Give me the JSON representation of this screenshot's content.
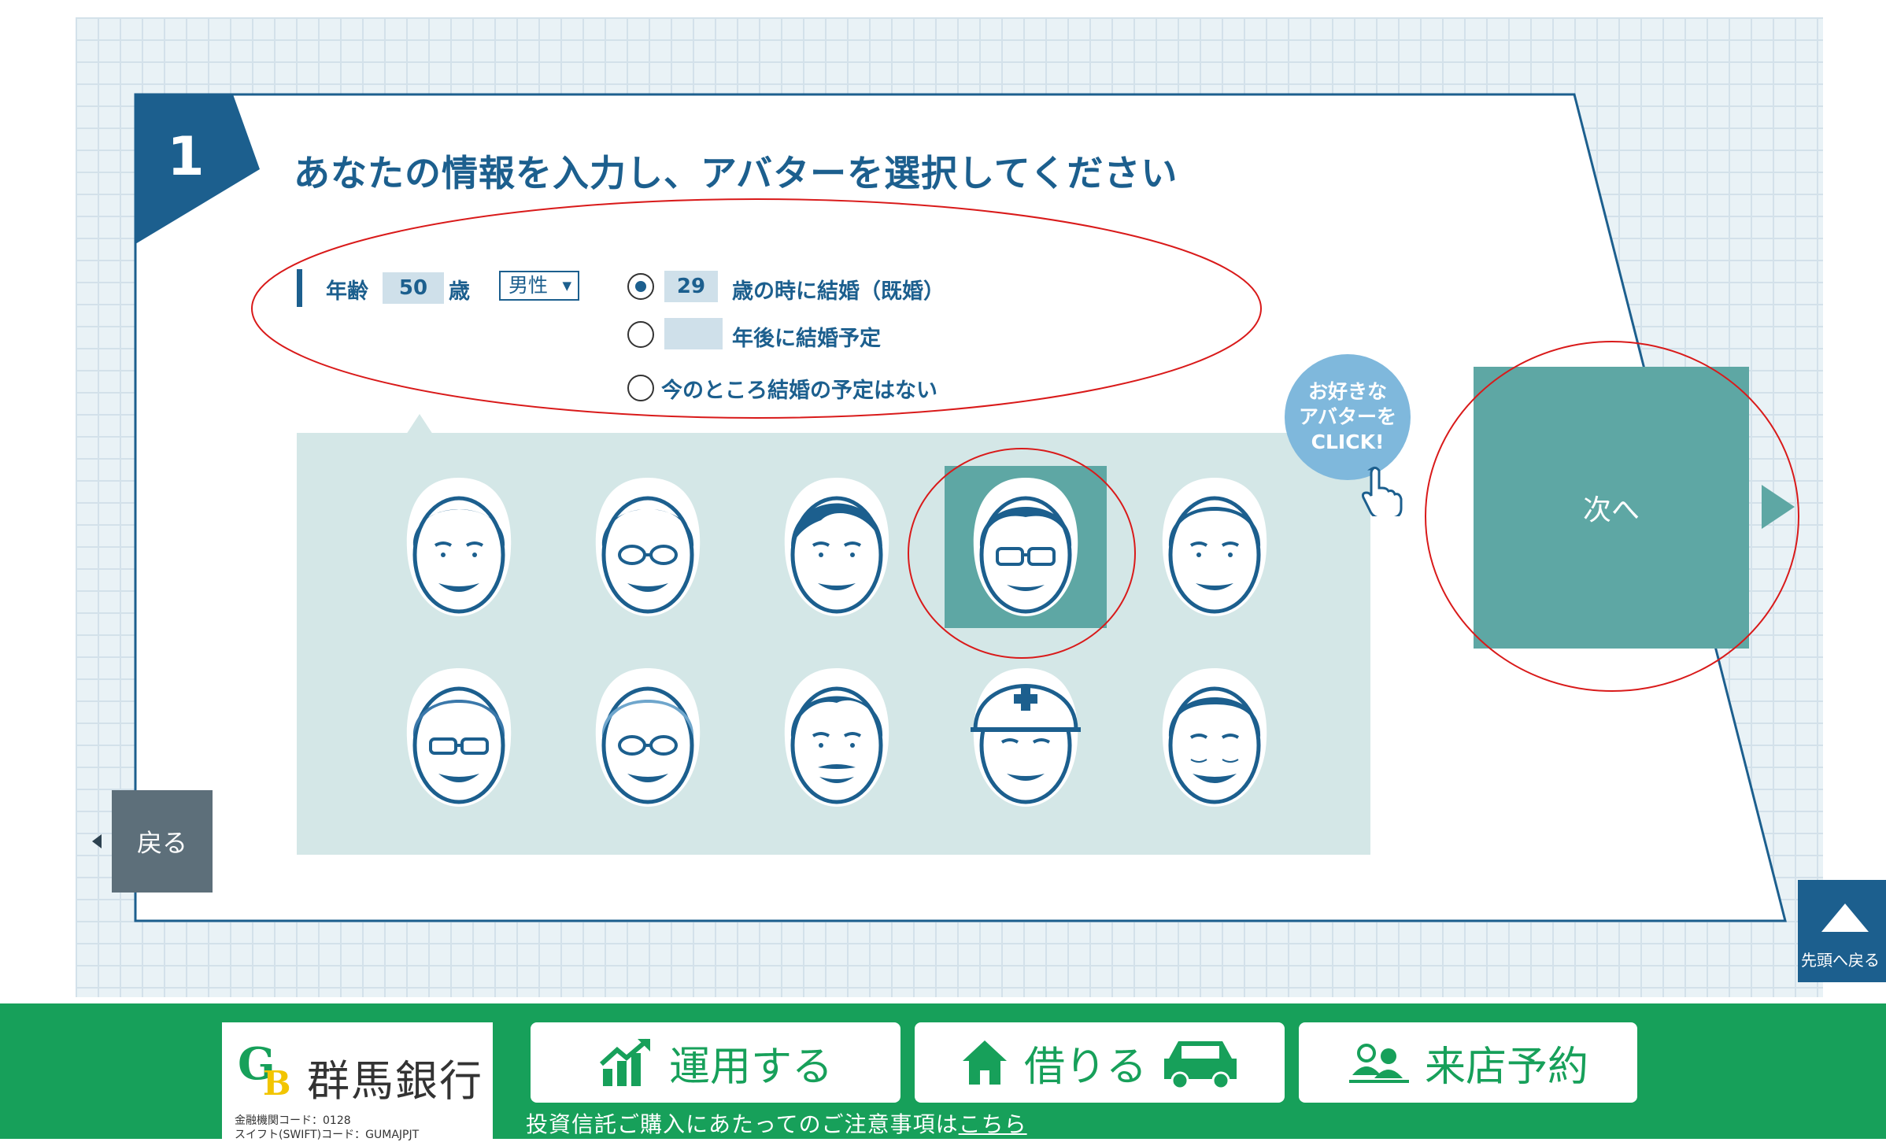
{
  "step": {
    "number": "1",
    "title": "あなたの情報を入力し、アバターを選択してください"
  },
  "form": {
    "age_label": "年齢",
    "age_value": "50",
    "age_unit": "歳",
    "gender_value": "男性",
    "marriage_options": [
      {
        "value": "29",
        "label": "歳の時に結婚（既婚）",
        "checked": true
      },
      {
        "value": "",
        "label": "年後に結婚予定",
        "checked": false
      },
      {
        "label": "今のところ結婚の予定はない",
        "checked": false
      }
    ]
  },
  "avatar_prompt": {
    "line1": "お好きな",
    "line2": "アバターを",
    "line3": "CLICK!"
  },
  "avatars": {
    "selected_index": 3,
    "count": 10
  },
  "buttons": {
    "next": "次へ",
    "back": "戻る",
    "scroll_top": "先頭へ戻る"
  },
  "footer": {
    "bank_name": "群馬銀行",
    "bank_code": "金融機関コード：0128",
    "swift_code": "スイフト(SWIFT)コード：GUMAJPJT",
    "nav": [
      {
        "label": "運用する",
        "icon": "chart-up-icon"
      },
      {
        "label": "借りる",
        "icon": "house-car-icon"
      },
      {
        "label": "来店予約",
        "icon": "people-icon"
      }
    ],
    "notice_text": "投資信託ご購入にあたってのご注意事項は",
    "notice_link": "こちら"
  },
  "colors": {
    "navy": "#1c5f8e",
    "teal": "#5ea7a4",
    "panel": "#d4e7e7",
    "footer_green": "#17a05a",
    "annotation_red": "#d91a1a"
  }
}
